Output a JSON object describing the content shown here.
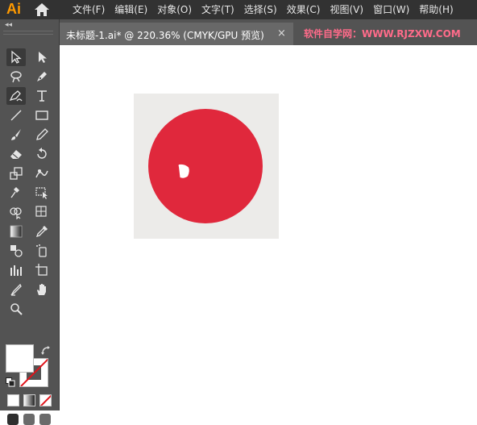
{
  "app": {
    "logo": "Ai"
  },
  "menu": {
    "items": [
      {
        "label": "文件(F)"
      },
      {
        "label": "编辑(E)"
      },
      {
        "label": "对象(O)"
      },
      {
        "label": "文字(T)"
      },
      {
        "label": "选择(S)"
      },
      {
        "label": "效果(C)"
      },
      {
        "label": "视图(V)"
      },
      {
        "label": "窗口(W)"
      },
      {
        "label": "帮助(H)"
      }
    ]
  },
  "tab": {
    "title": "未标题-1.ai* @ 220.36% (CMYK/GPU 预览)",
    "close": "×"
  },
  "watermark": "软件自学网：WWW.RJZXW.COM",
  "tools_panel": {
    "collapse": "◂◂"
  },
  "tools": [
    {
      "icon": "selection-tool-icon"
    },
    {
      "icon": "direct-selection-tool-icon"
    },
    {
      "icon": "magic-wand-tool-icon"
    },
    {
      "icon": "pen-tool-icon"
    },
    {
      "icon": "curvature-tool-icon"
    },
    {
      "icon": "type-tool-icon"
    },
    {
      "icon": "line-segment-tool-icon"
    },
    {
      "icon": "rectangle-tool-icon"
    },
    {
      "icon": "paintbrush-tool-icon"
    },
    {
      "icon": "pencil-tool-icon"
    },
    {
      "icon": "eraser-tool-icon"
    },
    {
      "icon": "rotate-tool-icon"
    },
    {
      "icon": "scale-tool-icon"
    },
    {
      "icon": "warp-tool-icon"
    },
    {
      "icon": "puppet-warp-tool-icon"
    },
    {
      "icon": "free-transform-tool-icon"
    },
    {
      "icon": "shape-builder-tool-icon"
    },
    {
      "icon": "live-paint-tool-icon"
    },
    {
      "icon": "perspective-grid-tool-icon"
    },
    {
      "icon": "mesh-tool-icon"
    },
    {
      "icon": "gradient-tool-icon"
    },
    {
      "icon": "eyedropper-tool-icon"
    },
    {
      "icon": "blend-tool-icon"
    },
    {
      "icon": "symbol-sprayer-tool-icon"
    },
    {
      "icon": "column-graph-tool-icon"
    },
    {
      "icon": "artboard-tool-icon"
    },
    {
      "icon": "slice-tool-icon"
    },
    {
      "icon": "hand-tool-icon"
    },
    {
      "icon": "zoom-tool-icon"
    }
  ],
  "colors": {
    "menubar": "#323232",
    "panel": "#535353",
    "artboard_bg": "#ecebe9",
    "circle_fill": "#e0283c",
    "highlight": "#ffffff",
    "none_slash": "#e0141b"
  }
}
